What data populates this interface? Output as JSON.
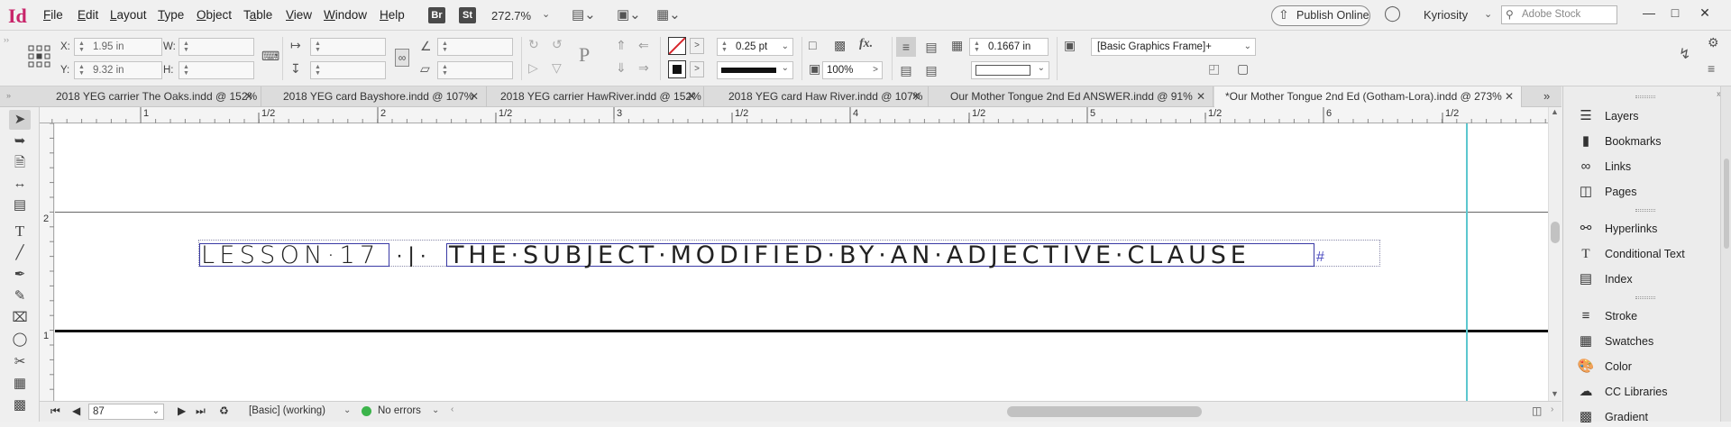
{
  "app": {
    "logo": "Id",
    "accent": "#c8256a"
  },
  "menus": [
    "File",
    "Edit",
    "Layout",
    "Type",
    "Object",
    "Table",
    "View",
    "Window",
    "Help"
  ],
  "menu_underline": [
    "F",
    "E",
    "L",
    "T",
    "O",
    "a",
    "V",
    "W",
    "H"
  ],
  "bridge_badge": "Br",
  "stock_badge": "St",
  "zoom": "272.7%",
  "publish_label": "Publish Online",
  "workspace": "Kyriosity",
  "search_placeholder": "Adobe Stock",
  "control": {
    "x_label": "X:",
    "x_value": "1.95 in",
    "y_label": "Y:",
    "y_value": "9.32 in",
    "w_label": "W:",
    "h_label": "H:",
    "stroke_weight": "0.25 pt",
    "opacity": "100%",
    "fx_label": "fx.",
    "gap_value": "0.1667 in",
    "object_style": "[Basic Graphics Frame]+"
  },
  "tabs": [
    {
      "label": "2018 YEG carrier The Oaks.indd @ 152%"
    },
    {
      "label": "2018 YEG card Bayshore.indd @ 107%"
    },
    {
      "label": "2018 YEG carrier HawRiver.indd @ 152%"
    },
    {
      "label": "2018 YEG card Haw River.indd @ 107%"
    },
    {
      "label": "Our Mother Tongue 2nd Ed ANSWER.indd @ 91%"
    },
    {
      "label": "*Our Mother Tongue 2nd Ed (Gotham-Lora).indd @ 273%"
    }
  ],
  "ruler": {
    "numbers": [
      "1",
      "1/2",
      "2",
      "1/2",
      "3",
      "1/2",
      "4",
      "1/2",
      "5",
      "1/2",
      "6",
      "1/2"
    ],
    "v_numbers": [
      "2",
      "1"
    ]
  },
  "document": {
    "lesson_text": "LESSON·17",
    "separator": "·|·",
    "heading_text": "THE·SUBJECT·MODIFIED·BY·AN·ADJECTIVE·CLAUSE",
    "end_mark": "#"
  },
  "status": {
    "page": "87",
    "master": "[Basic] (working)",
    "preflight": "No errors",
    "preflight_color": "#3cb44b"
  },
  "panels": [
    "Layers",
    "Bookmarks",
    "Links",
    "Pages",
    "Hyperlinks",
    "Conditional Text",
    "Index",
    "Stroke",
    "Swatches",
    "Color",
    "CC Libraries",
    "Gradient"
  ]
}
